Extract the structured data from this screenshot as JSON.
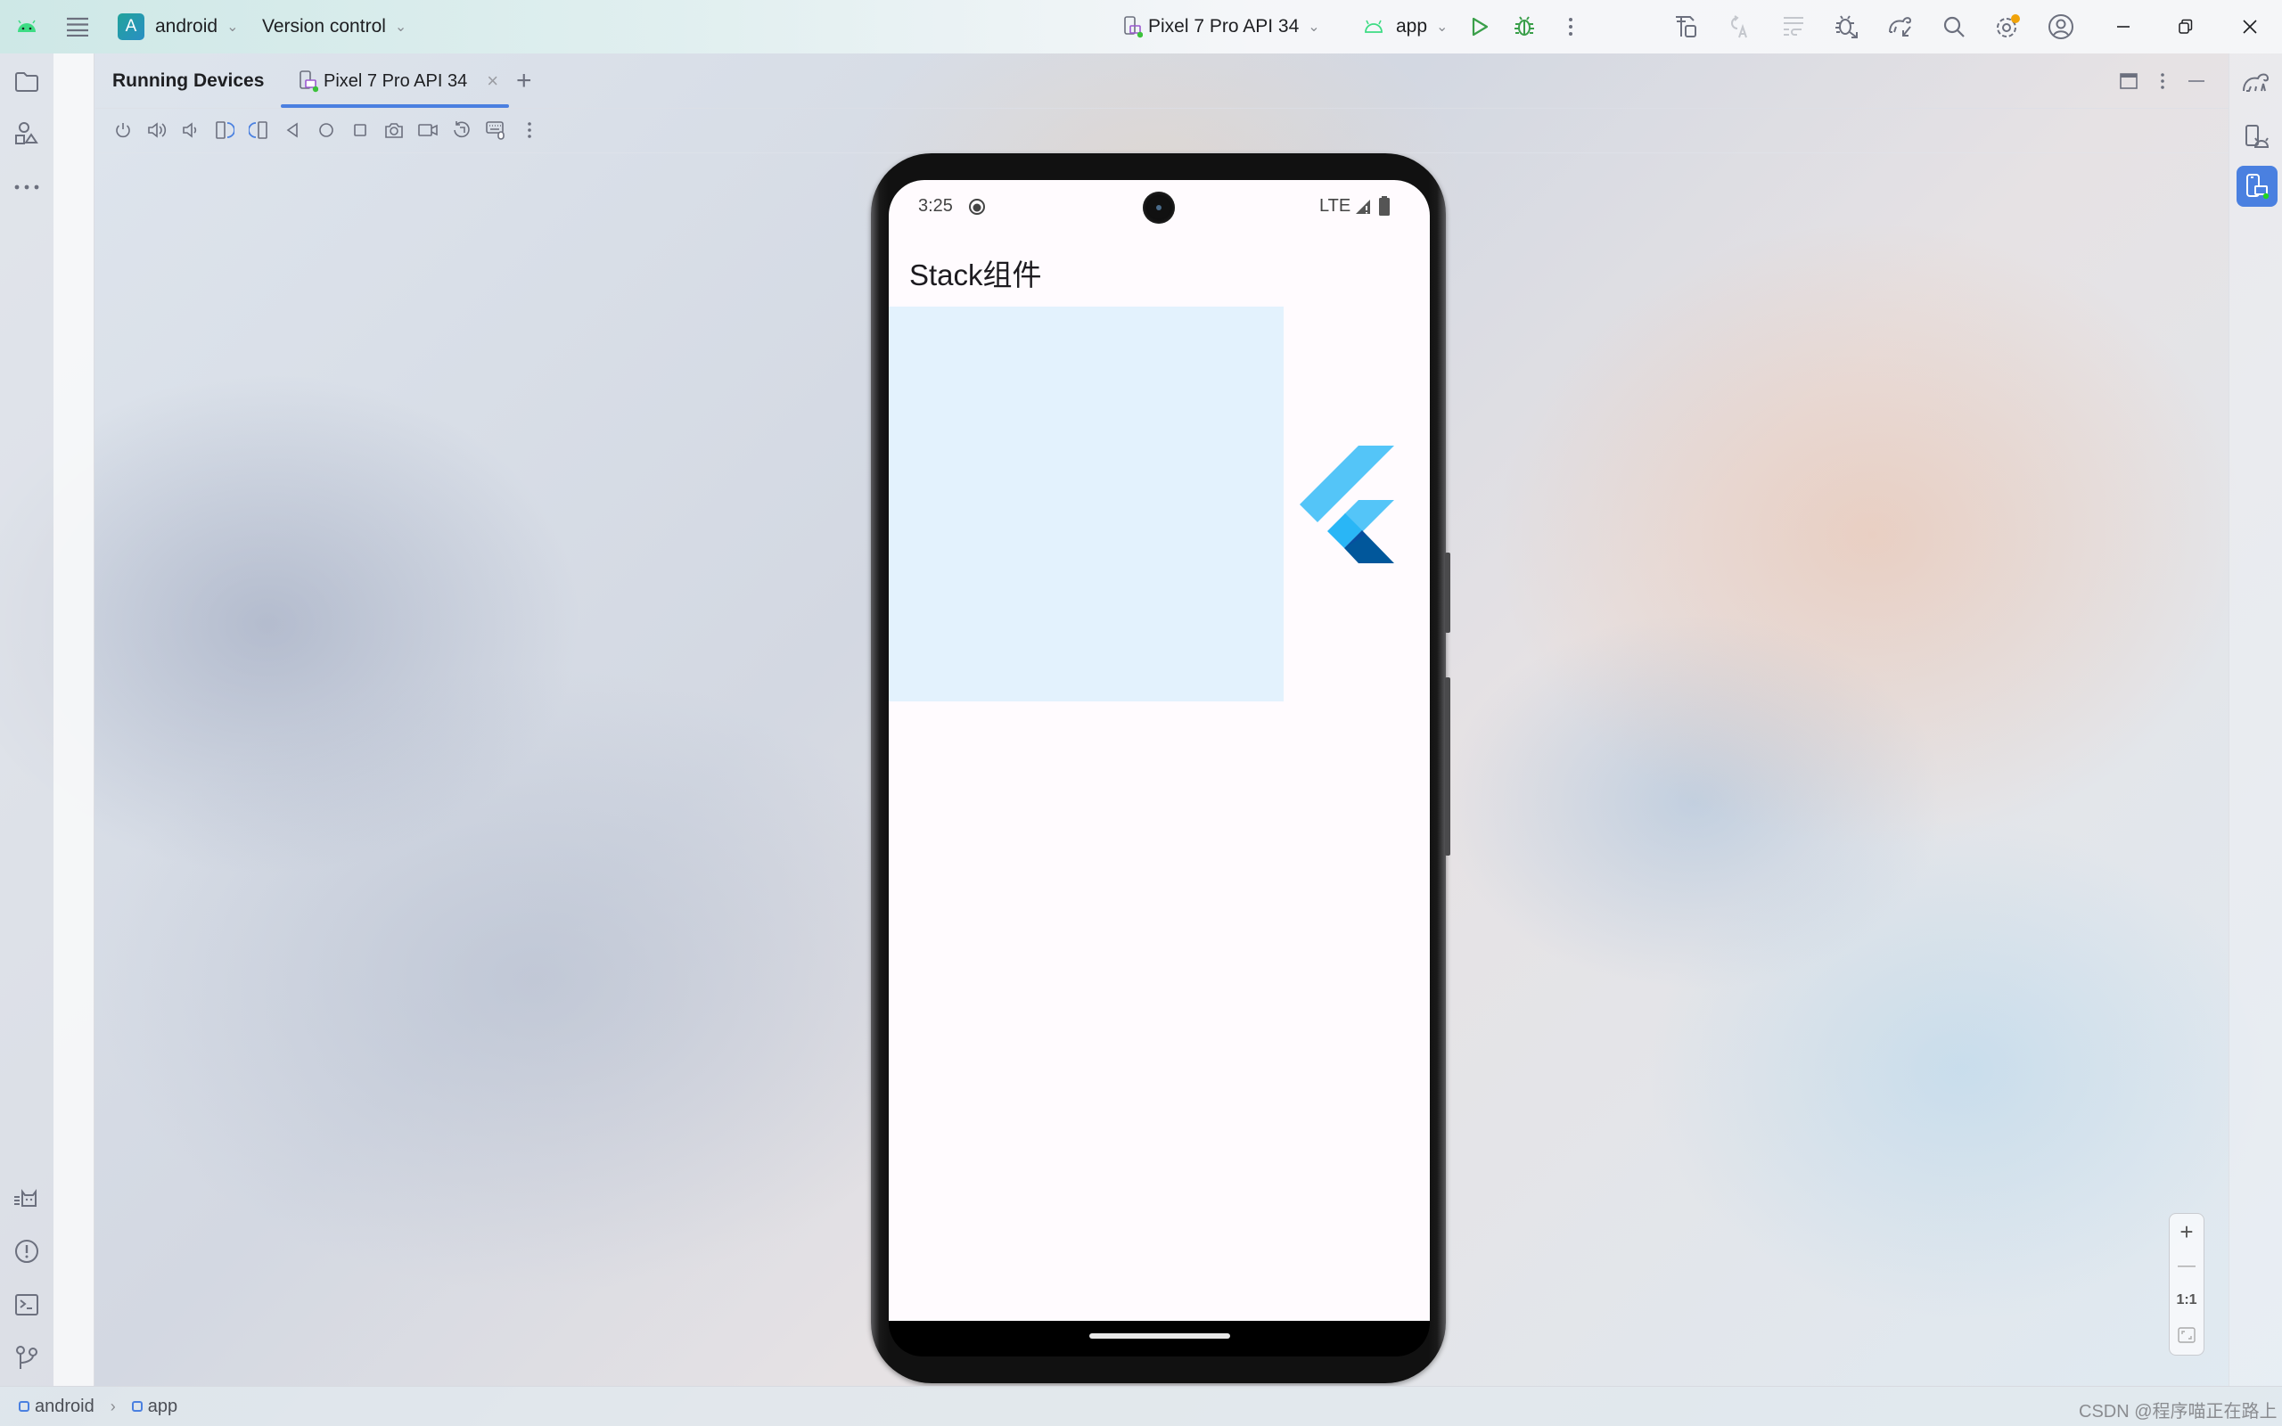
{
  "titlebar": {
    "project_badge": "A",
    "project_name": "android",
    "version_control": "Version control",
    "device_selector": "Pixel 7 Pro API 34",
    "run_config": "app",
    "icons": [
      "android-logo-icon",
      "main-menu-icon",
      "run-icon",
      "debug-icon",
      "more-icon",
      "build-icon",
      "apply-changes-icon",
      "apply-code-changes-icon",
      "attach-debugger-icon",
      "gradle-sync-icon",
      "search-icon",
      "settings-icon",
      "account-icon",
      "minimize-icon",
      "restore-icon",
      "close-icon"
    ]
  },
  "left_sidebar": {
    "top_icons": [
      "project-folder-icon",
      "resource-manager-icon",
      "more-tools-icon"
    ],
    "bottom_icons": [
      "logcat-icon",
      "problems-icon",
      "terminal-icon",
      "version-control-icon"
    ]
  },
  "right_sidebar": {
    "icons": [
      "gradle-icon",
      "device-manager-icon",
      "running-devices-icon"
    ]
  },
  "running_devices": {
    "title": "Running Devices",
    "tabs": [
      {
        "label": "Pixel 7 Pro API 34",
        "active": true
      }
    ],
    "add_tab": "+",
    "close_tab": "×",
    "toolbar": [
      "power",
      "volume-up",
      "volume-down",
      "rotate-left",
      "rotate-right",
      "back",
      "home",
      "overview",
      "screenshot",
      "screen-record",
      "reset-rotation",
      "keyboard-input",
      "more"
    ]
  },
  "device": {
    "status_time": "3:25",
    "network": "LTE",
    "app_title": "Stack组件",
    "blue_box_color": "#e3f2fd",
    "flutter_colors": [
      "#54c5f8",
      "#29b6f6",
      "#01579b"
    ]
  },
  "zoom_controls": {
    "zoom_in": "+",
    "zoom_out": "—",
    "actual_size": "1:1"
  },
  "statusbar": {
    "breadcrumb": [
      "android",
      "app"
    ]
  },
  "watermark": "CSDN @程序喵正在路上"
}
